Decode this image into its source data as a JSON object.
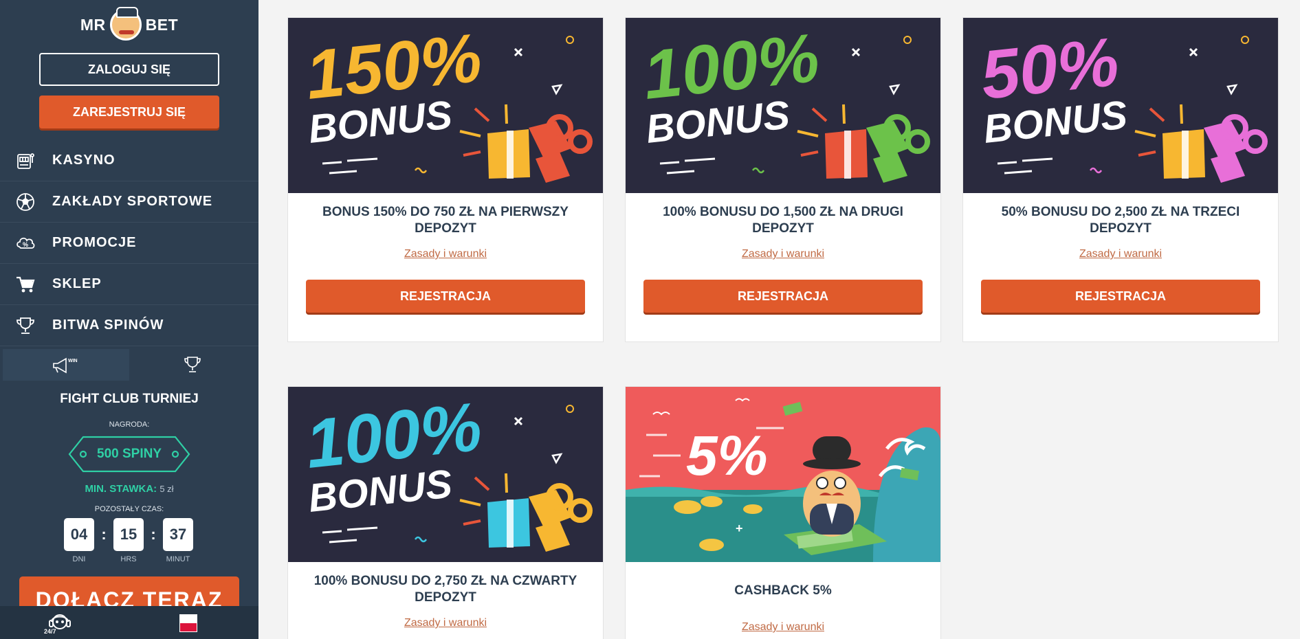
{
  "brand": {
    "left": "MR",
    "right": "BET"
  },
  "auth": {
    "login_label": "ZALOGUJ SIĘ",
    "register_label": "ZAREJESTRUJ SIĘ"
  },
  "nav": [
    {
      "label": "KASYNO",
      "icon": "slot-machine-icon"
    },
    {
      "label": "ZAKŁADY SPORTOWE",
      "icon": "soccer-ball-icon"
    },
    {
      "label": "PROMOCJE",
      "icon": "promo-percent-icon"
    },
    {
      "label": "SKLEP",
      "icon": "cart-icon"
    },
    {
      "label": "BITWA SPINÓW",
      "icon": "trophy-icon"
    }
  ],
  "tournament": {
    "tab_win_text": "WIN",
    "title": "FIGHT CLUB TURNIEJ",
    "prize_label": "NAGRODA:",
    "prize_value": "500 SPINY",
    "min_bet_label": "MIN. STAWKA:",
    "min_bet_value": "5 zł",
    "time_label": "POZOSTAŁY CZAS:",
    "timer": [
      {
        "value": "04",
        "unit": "DNI"
      },
      {
        "value": "15",
        "unit": "HRS"
      },
      {
        "value": "37",
        "unit": "MINUT"
      }
    ],
    "separator": ":",
    "join_label": "DOŁĄCZ TERAZ"
  },
  "footer": {
    "support_text": "24/7"
  },
  "colors": {
    "accent": "#e05a2b",
    "sidebar": "#2d3e50",
    "teal": "#2fd0a5"
  },
  "promos": [
    {
      "percent": "150%",
      "banner_word": "BONUS",
      "percent_color": "#f7b731",
      "gift_color": "#f7b731",
      "bow_color": "#e8553a",
      "title": "BONUS 150% DO 750 ZŁ NA PIERWSZY DEPOZYT",
      "link": "Zasady i warunki",
      "button": "REJESTRACJA"
    },
    {
      "percent": "100%",
      "banner_word": "BONUS",
      "percent_color": "#6cc24a",
      "gift_color": "#e8553a",
      "bow_color": "#6cc24a",
      "title": "100% BONUSU DO 1,500 ZŁ NA DRUGI DEPOZYT",
      "link": "Zasady i warunki",
      "button": "REJESTRACJA"
    },
    {
      "percent": "50%",
      "banner_word": "BONUS",
      "percent_color": "#e86fd8",
      "gift_color": "#f7b731",
      "bow_color": "#e86fd8",
      "title": "50% BONUSU DO 2,500 ZŁ NA TRZECI DEPOZYT",
      "link": "Zasady i warunki",
      "button": "REJESTRACJA"
    },
    {
      "percent": "100%",
      "banner_word": "BONUS",
      "percent_color": "#3cc6e0",
      "gift_color": "#3cc6e0",
      "bow_color": "#f7b731",
      "title": "100% BONUSU DO 2,750 ZŁ NA CZWARTY DEPOZYT",
      "link": "Zasady i warunki"
    },
    {
      "percent": "5%",
      "title": "CASHBACK 5%",
      "link": "Zasady i warunki"
    }
  ]
}
